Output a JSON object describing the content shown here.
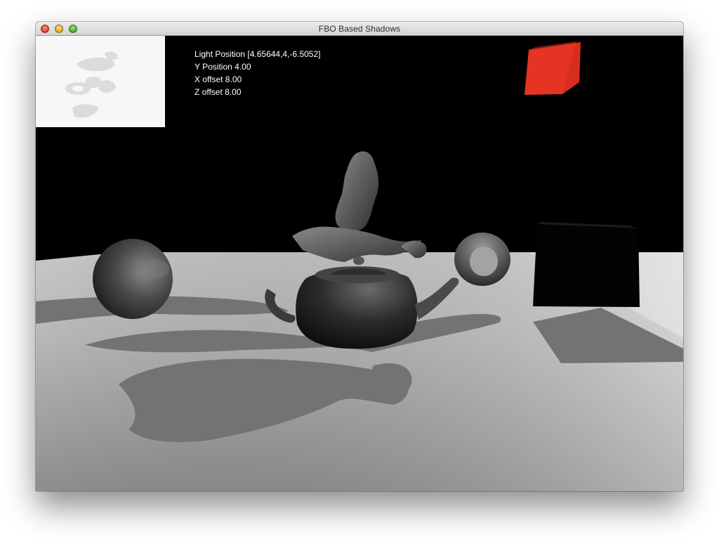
{
  "window": {
    "title": "FBO Based Shadows"
  },
  "overlay": {
    "light_position": "Light Position [4.65644,4,-6.5052]",
    "y_position": "Y Position 4.00",
    "x_offset": "X offset 8.00",
    "z_offset": "Z offset 8.00"
  },
  "colors": {
    "background": "#000000",
    "light_cube": "#e53424",
    "shadow_map": "#f7f7f7"
  },
  "icons": {
    "close": "close-icon",
    "minimize": "minimize-icon",
    "zoom": "zoom-icon"
  }
}
